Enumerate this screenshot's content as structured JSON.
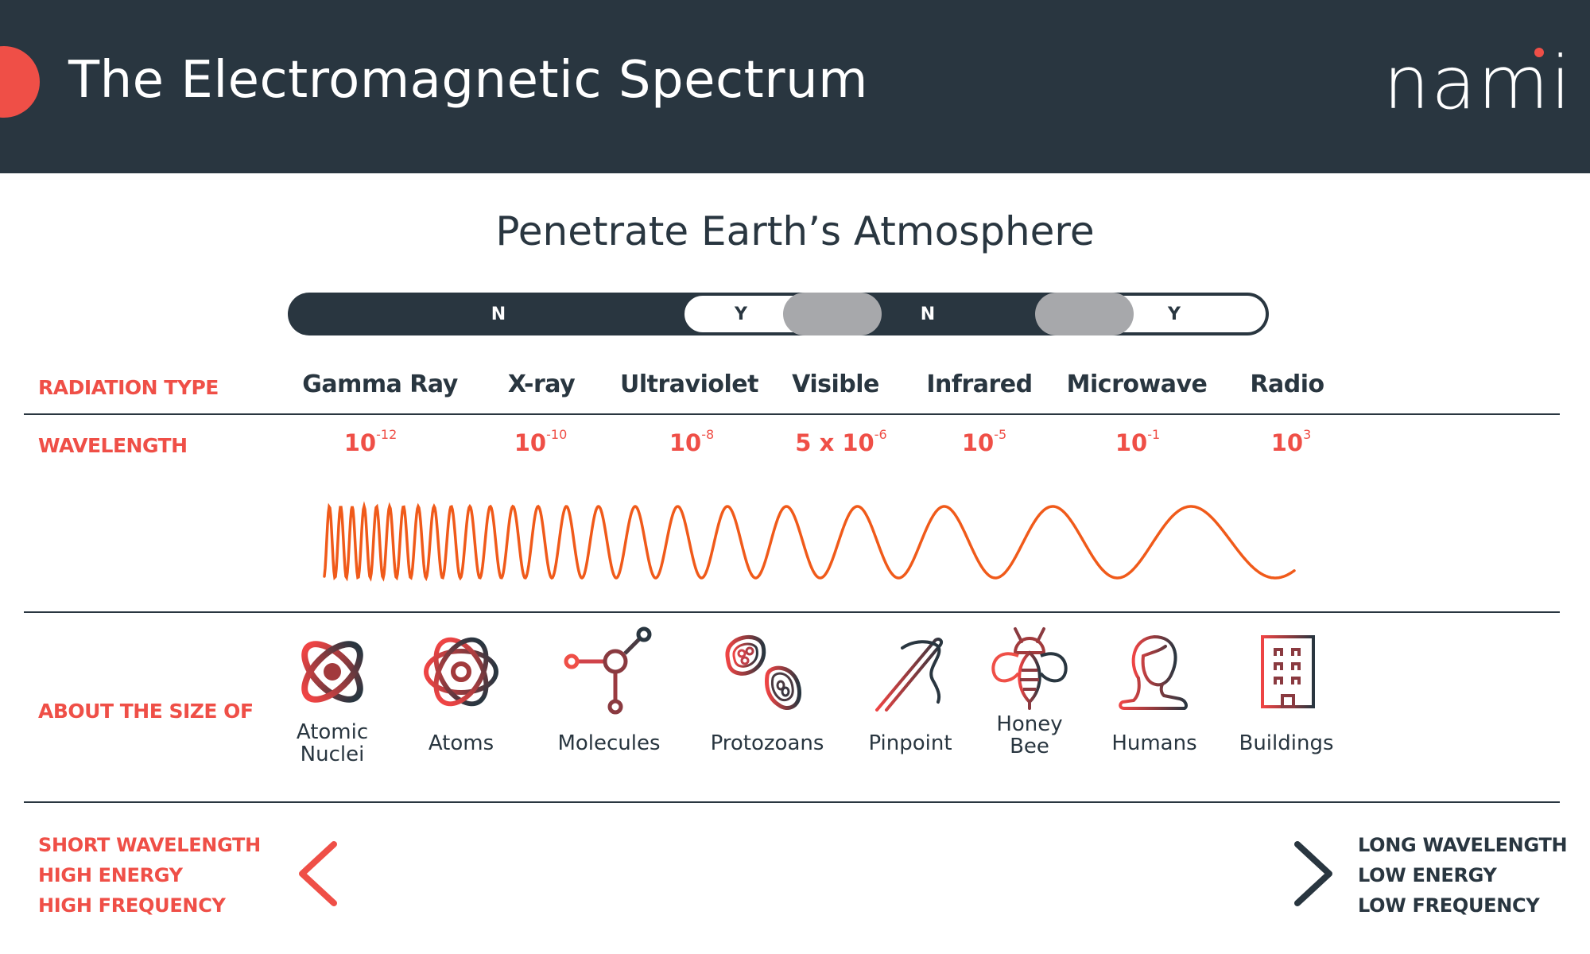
{
  "header": {
    "title": "The Electromagnetic Spectrum",
    "logo": "nami",
    "accent_color": "#ef4f47",
    "background_color": "#293640"
  },
  "atmosphere": {
    "title": "Penetrate Earth’s Atmosphere",
    "segments": [
      {
        "label": "N",
        "penetrates": false
      },
      {
        "label": "Y",
        "penetrates": true
      },
      {
        "label": "",
        "penetrates": "partial"
      },
      {
        "label": "N",
        "penetrates": false
      },
      {
        "label": "",
        "penetrates": "partial"
      },
      {
        "label": "Y",
        "penetrates": true
      }
    ]
  },
  "rows": {
    "radiation_type": "RADIATION TYPE",
    "wavelength": "WAVELENGTH",
    "size": "ABOUT THE SIZE OF"
  },
  "radiation_types": [
    {
      "name": "Gamma Ray",
      "base": "10",
      "exp": "-12"
    },
    {
      "name": "X-ray",
      "base": "10",
      "exp": "-10"
    },
    {
      "name": "Ultraviolet",
      "base": "10",
      "exp": "-8"
    },
    {
      "name": "Visible",
      "base": "5 x 10",
      "exp": "-6"
    },
    {
      "name": "Infrared",
      "base": "10",
      "exp": "-5"
    },
    {
      "name": "Microwave",
      "base": "10",
      "exp": "-1"
    },
    {
      "name": "Radio",
      "base": "10",
      "exp": "3"
    }
  ],
  "sizes": [
    {
      "line1": "Atomic",
      "line2": "Nuclei",
      "icon": "atom-nucleus-icon"
    },
    {
      "line1": "Atoms",
      "line2": "",
      "icon": "atom-icon"
    },
    {
      "line1": "Molecules",
      "line2": "",
      "icon": "molecule-icon"
    },
    {
      "line1": "Protozoans",
      "line2": "",
      "icon": "protozoa-icon"
    },
    {
      "line1": "Pinpoint",
      "line2": "",
      "icon": "needle-icon"
    },
    {
      "line1": "Honey",
      "line2": "Bee",
      "icon": "bee-icon"
    },
    {
      "line1": "Humans",
      "line2": "",
      "icon": "person-icon"
    },
    {
      "line1": "Buildings",
      "line2": "",
      "icon": "building-icon"
    }
  ],
  "scale": {
    "left": [
      "SHORT WAVELENGTH",
      "HIGH ENERGY",
      "HIGH FREQUENCY"
    ],
    "right": [
      "LONG WAVELENGTH",
      "LOW ENERGY",
      "LOW FREQUENCY"
    ]
  },
  "wave_color": "#f05a1a"
}
